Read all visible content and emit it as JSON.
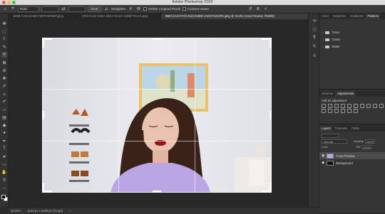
{
  "window": {
    "title": "Adobe Photoshop 2020"
  },
  "options_bar": {
    "ratio_label": "Ratio",
    "clear_label": "Clear",
    "straighten_label": "Straighten",
    "delete_cropped_label": "Delete Cropped Pixels",
    "content_aware_label": "Content-Aware"
  },
  "tabs": [
    {
      "label": "4D9B-4A66-BAB6-F3EF53006BF.jpeg"
    },
    {
      "label": "AF6A4AAE-D4EA-4BAA-8A1D-12EBF7D1A4.jpeg"
    },
    {
      "label": "8BEA1A4-07C9-411D-B4B8-1ADCF3222F8.jpeg @ 33.3% (Crop Preview, RGB/8)"
    }
  ],
  "status": {
    "zoom": "33.33%",
    "doc_size": "3144 px x 2438 px (72 ppi)"
  },
  "swatches_panel": {
    "tabs": [
      "Color",
      "Swatches",
      "Gradients",
      "Patterns"
    ],
    "active": "Patterns",
    "folders": [
      "Trees",
      "Grass",
      "Water"
    ]
  },
  "adjustments_panel": {
    "tabs": [
      "Libraries",
      "Adjustments"
    ],
    "active": "Adjustments",
    "subtitle": "Add an adjustment"
  },
  "layers_panel": {
    "tabs": [
      "Layers",
      "Channels",
      "Paths"
    ],
    "active": "Layers",
    "blend_mode": "Normal",
    "opacity_label": "Opacity:",
    "opacity_value": "100%",
    "lock_label": "Lock:",
    "fill_label": "Fill:",
    "fill_value": "100%",
    "layers": [
      {
        "name": "Crop Preview",
        "selected": true
      },
      {
        "name": "Background",
        "selected": false
      }
    ]
  },
  "colors": {
    "accent": "#2e68c9",
    "traffic_red": "#f25c54",
    "traffic_yellow": "#f5bd3a",
    "traffic_green": "#3ec748"
  },
  "icons": [
    "move-icon",
    "marquee-icon",
    "lasso-icon",
    "quick-select-icon",
    "crop-icon",
    "frame-icon",
    "eyedropper-icon",
    "healing-icon",
    "brush-icon",
    "stamp-icon",
    "history-brush-icon",
    "eraser-icon",
    "gradient-icon",
    "blur-icon",
    "dodge-icon",
    "pen-icon",
    "type-icon",
    "path-select-icon",
    "shape-icon",
    "hand-icon",
    "zoom-icon"
  ]
}
